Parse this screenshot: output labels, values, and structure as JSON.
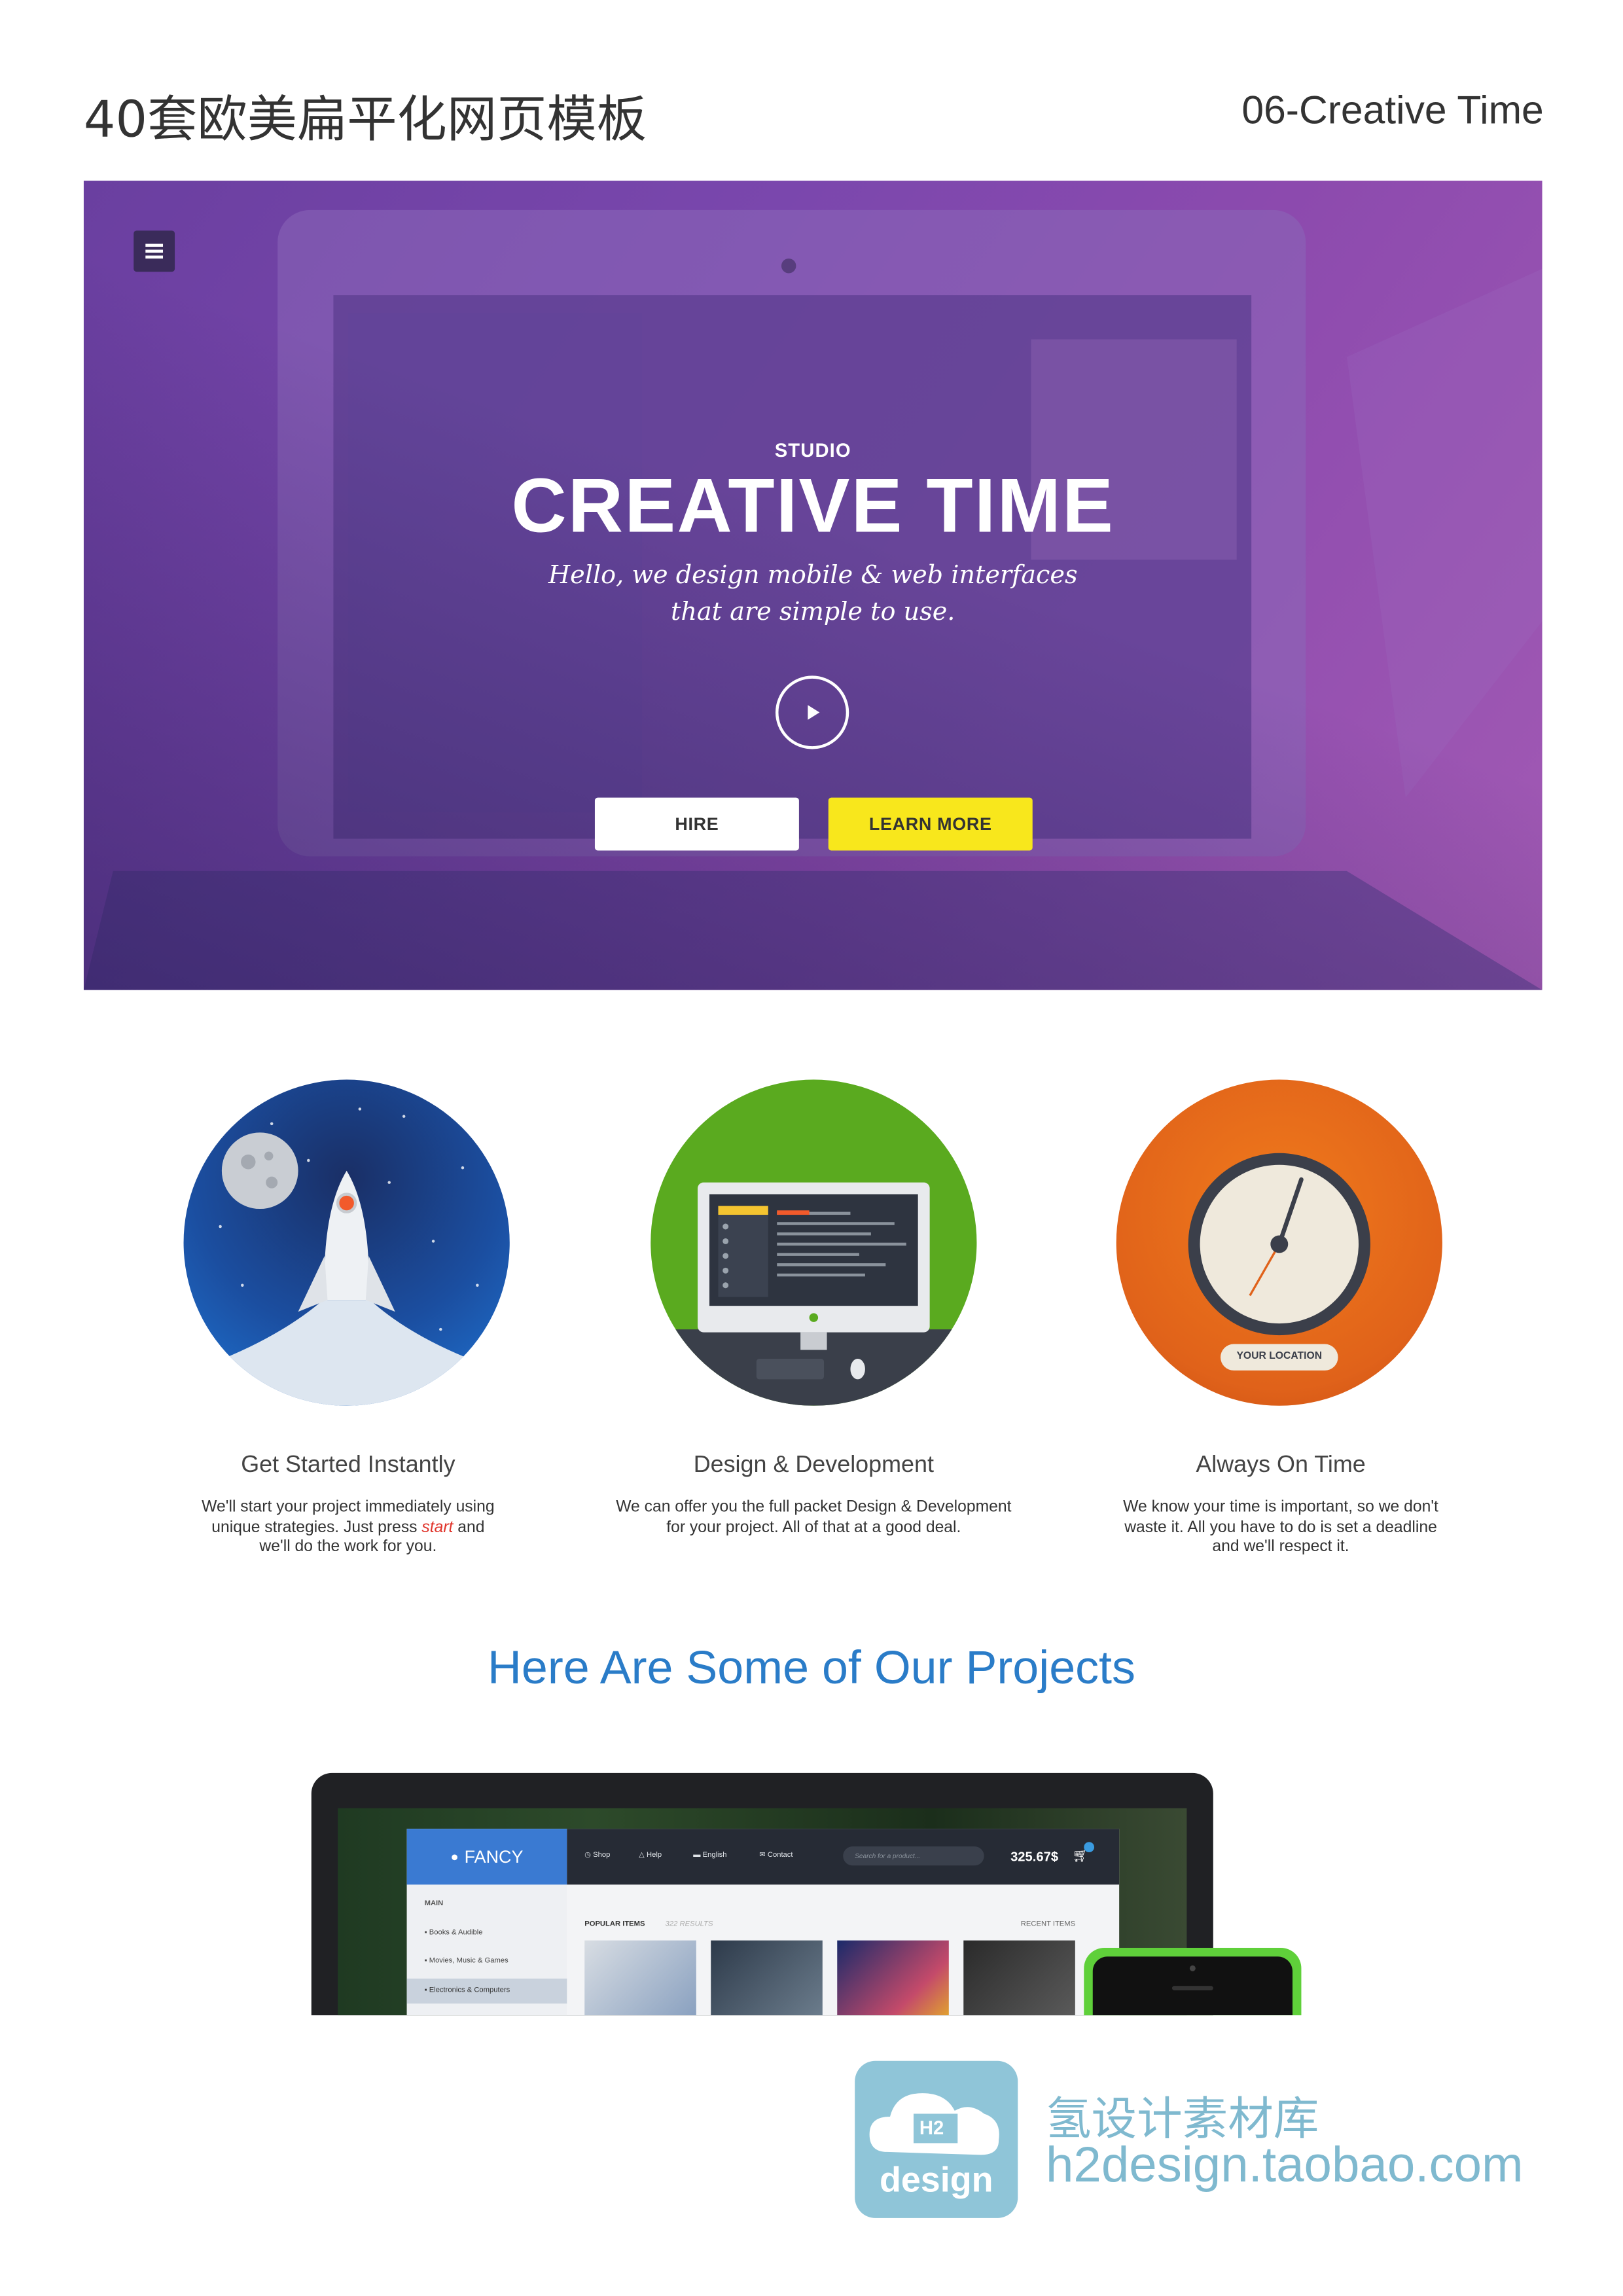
{
  "header": {
    "title_cn": "40套欧美扁平化网页模板",
    "subtitle": "06-Creative Time"
  },
  "hero": {
    "eyebrow": "STUDIO",
    "title": "CREATIVE TIME",
    "subtitle_line1": "Hello, we design mobile & web interfaces",
    "subtitle_line2": "that are simple to use.",
    "hire_label": "HIRE",
    "learn_more_label": "LEARN MORE"
  },
  "features": [
    {
      "title": "Get Started Instantly",
      "desc_line1": "We'll start your project immediately using",
      "desc_line2_pre": "unique strategies. Just press ",
      "desc_line2_link": "start",
      "desc_line2_post": " and",
      "desc_line3": "we'll do the work for you."
    },
    {
      "title": "Design & Development",
      "desc_line1": "We can offer you the full packet Design & Development",
      "desc_line2": "for your project. All of that at a good deal."
    },
    {
      "title": "Always On Time",
      "desc_line1": "We know your time is important, so we don't",
      "desc_line2": "waste it. All you have to do is set a deadline",
      "desc_line3": "and we'll respect it.",
      "badge": "YOUR LOCATION"
    }
  ],
  "projects": {
    "heading": "Here Are Some of Our Projects",
    "mock": {
      "brand": "FANCY",
      "nav": [
        "Shop",
        "Help",
        "English",
        "Contact"
      ],
      "search_placeholder": "Search for a product...",
      "cart_total": "325.67$",
      "sidebar_section": "MAIN",
      "sidebar_items": [
        "Books & Audible",
        "Movies, Music & Games",
        "Electronics & Computers"
      ],
      "popular_label": "POPULAR ITEMS",
      "results_label": "322 RESULTS",
      "recent_label": "RECENT ITEMS"
    }
  },
  "watermark": {
    "logo_text": "design",
    "logo_mark": "H2",
    "name_cn": "氢设计素材库",
    "url": "h2design.taobao.com"
  },
  "colors": {
    "hero_purple": "#7a47ad",
    "learn_more_yellow": "#f8e71c",
    "heading_blue": "#2a7cc8",
    "start_red": "#e0342b",
    "watermark_blue": "#7fb9cf"
  }
}
